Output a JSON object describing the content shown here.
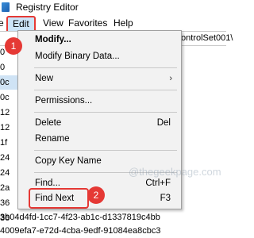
{
  "window": {
    "title": "Registry Editor"
  },
  "menubar": {
    "file": "e",
    "edit": "Edit",
    "view": "View",
    "favorites": "Favorites",
    "help": "Help"
  },
  "address": {
    "path": "ontrolSet001\\"
  },
  "tree_fragments": [
    {
      "text": "0",
      "selected": false
    },
    {
      "text": "0",
      "selected": false
    },
    {
      "text": "0c",
      "selected": true
    },
    {
      "text": "0c",
      "selected": false
    },
    {
      "text": "12",
      "selected": false
    },
    {
      "text": "12",
      "selected": false
    },
    {
      "text": "1f",
      "selected": false
    },
    {
      "text": "24",
      "selected": false
    },
    {
      "text": "24",
      "selected": false
    },
    {
      "text": "2a",
      "selected": false
    },
    {
      "text": "36",
      "selected": false
    },
    {
      "text": "36",
      "selected": false
    }
  ],
  "guids": [
    "3b04d4fd-1cc7-4f23-ab1c-d1337819c4bb",
    "4009efa7-e72d-4cba-9edf-91084ea8cbc3"
  ],
  "edit_menu": {
    "modify": "Modify...",
    "modify_binary": "Modify Binary Data...",
    "new": "New",
    "new_arrow": "›",
    "permissions": "Permissions...",
    "delete": "Delete",
    "delete_shortcut": "Del",
    "rename": "Rename",
    "copy_key_name": "Copy Key Name",
    "find": "Find...",
    "find_shortcut": "Ctrl+F",
    "find_next": "Find Next",
    "find_next_shortcut": "F3"
  },
  "annotations": {
    "step1": "1",
    "step2": "2"
  },
  "watermark": "@thegeekpage.com",
  "colors": {
    "highlight_red": "#e53935",
    "menu_bg": "#f2f2f2",
    "selection": "#cce4f7"
  }
}
